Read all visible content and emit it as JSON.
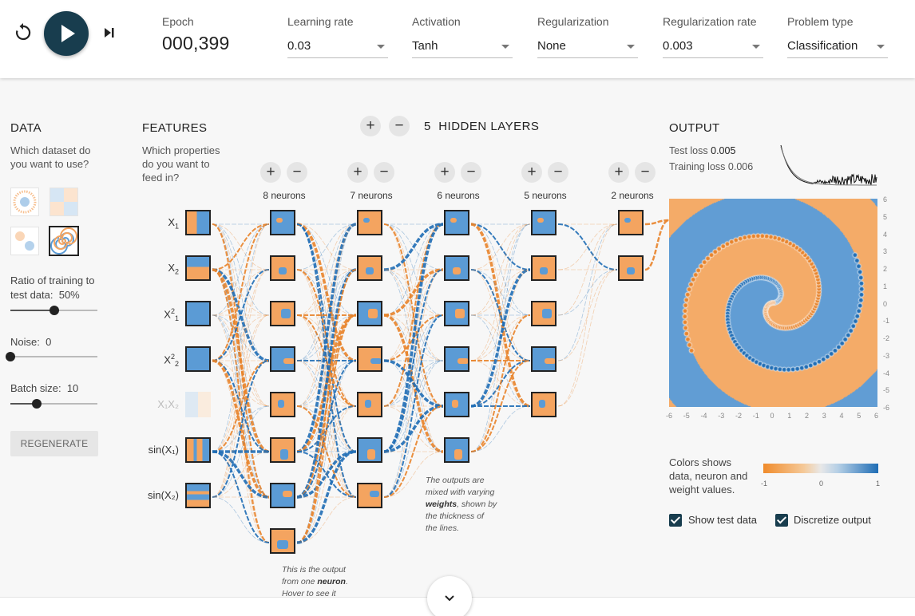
{
  "toolbar": {
    "epoch_label": "Epoch",
    "epoch_value": "000,399",
    "controls": [
      {
        "label": "Learning rate",
        "value": "0.03"
      },
      {
        "label": "Activation",
        "value": "Tanh"
      },
      {
        "label": "Regularization",
        "value": "None"
      },
      {
        "label": "Regularization rate",
        "value": "0.003"
      },
      {
        "label": "Problem type",
        "value": "Classification"
      }
    ],
    "icons": {
      "reset": "reset-icon",
      "play": "play-icon",
      "step": "step-forward-icon"
    }
  },
  "data_panel": {
    "title": "DATA",
    "subtitle": "Which dataset do you want to use?",
    "datasets": [
      "circle",
      "xor",
      "gaussian",
      "spiral"
    ],
    "selected_dataset": "spiral",
    "ratio_label": "Ratio of training to test data:",
    "ratio_value": "50%",
    "ratio_fraction": 0.5,
    "noise_label": "Noise:",
    "noise_value": "0",
    "noise_fraction": 0,
    "batch_label": "Batch size:",
    "batch_value": "10",
    "batch_fraction": 0.3,
    "regenerate_label": "REGENERATE"
  },
  "features_panel": {
    "title": "FEATURES",
    "subtitle": "Which properties do you want to feed in?",
    "features": [
      {
        "label": "X",
        "sub": "1",
        "sup": "",
        "active": true
      },
      {
        "label": "X",
        "sub": "2",
        "sup": "",
        "active": true
      },
      {
        "label": "X",
        "sub": "1",
        "sup": "2",
        "active": true
      },
      {
        "label": "X",
        "sub": "2",
        "sup": "2",
        "active": true
      },
      {
        "label": "X₁X₂",
        "sub": "",
        "sup": "",
        "active": false
      },
      {
        "label": "sin(X₁)",
        "sub": "",
        "sup": "",
        "active": true
      },
      {
        "label": "sin(X₂)",
        "sub": "",
        "sup": "",
        "active": true
      }
    ]
  },
  "network": {
    "hidden_layers_count": "5",
    "hidden_layers_label": "HIDDEN LAYERS",
    "layers": [
      {
        "neurons": 8,
        "label": "8 neurons"
      },
      {
        "neurons": 7,
        "label": "7 neurons"
      },
      {
        "neurons": 6,
        "label": "6 neurons"
      },
      {
        "neurons": 5,
        "label": "5 neurons"
      },
      {
        "neurons": 2,
        "label": "2 neurons"
      }
    ],
    "note_weights": {
      "pre": "The outputs are mixed with varying",
      "bold": "weights",
      "post": ", shown by the thickness of the lines."
    },
    "note_neuron": {
      "pre": "This is the output from one",
      "bold": "neuron",
      "post": ". Hover to see it larger."
    }
  },
  "output_panel": {
    "title": "OUTPUT",
    "test_loss_label": "Test loss",
    "test_loss_value": "0.005",
    "train_loss_label": "Training loss",
    "train_loss_value": "0.006",
    "axis_ticks": [
      "-6",
      "-5",
      "-4",
      "-3",
      "-2",
      "-1",
      "0",
      "1",
      "2",
      "3",
      "4",
      "5",
      "6"
    ],
    "colors_label": "Colors shows data, neuron and weight values.",
    "colorbar_ticks": [
      "-1",
      "0",
      "1"
    ],
    "show_test_data_label": "Show test data",
    "show_test_data_checked": true,
    "discretize_label": "Discretize output",
    "discretize_checked": true
  },
  "colors": {
    "orange": "#f4a460",
    "blue": "#5b9bd5",
    "dark_orange": "#e8832a",
    "dark_blue": "#1f6db5",
    "play_button": "#183d4e"
  }
}
